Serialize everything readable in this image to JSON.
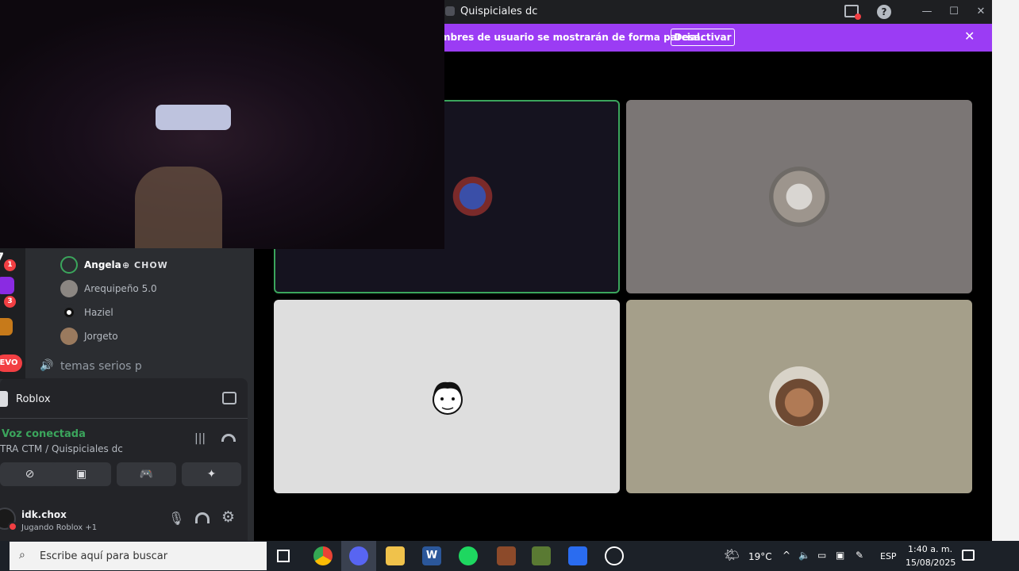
{
  "window": {
    "title": "Quispiciales dc",
    "buttons": [
      "—",
      "☐",
      "✕"
    ]
  },
  "banner": {
    "text": "mbres de usuario se mostrarán de forma parcial.",
    "action_label": "Desactivar"
  },
  "sidebar": {
    "servers": [
      {
        "badge": "1",
        "mark": "7"
      },
      {
        "badge": "3",
        "mark": ""
      },
      {
        "badge": "",
        "mark": ""
      },
      {
        "badge": "",
        "mark": "EVO"
      }
    ],
    "voice_members": [
      {
        "name": "Angela",
        "tag": "⊕ CHOW",
        "speaking": true
      },
      {
        "name": "Arequipeño 5.0",
        "tag": "",
        "speaking": false
      },
      {
        "name": "Haziel",
        "tag": "",
        "speaking": false
      },
      {
        "name": "Jorgeto",
        "tag": "",
        "speaking": false
      }
    ],
    "channel": "temas serios p",
    "activity": {
      "label": "Roblox"
    },
    "voice_status": {
      "title": "Voz conectada",
      "location": "TRA CTM / Quispiciales dc"
    },
    "user": {
      "name": "idk.chox",
      "status": "Jugando Roblox +1"
    }
  },
  "taskbar": {
    "search_placeholder": "Escribe aquí para buscar",
    "weather": "19°C",
    "language": "ESP",
    "time": "1:40 a. m.",
    "date": "15/08/2025"
  },
  "colors": {
    "banner": "#9b3cf4",
    "speaking_border": "#3ba55c",
    "voice_connected": "#3ba55c",
    "badge": "#f23f43"
  }
}
